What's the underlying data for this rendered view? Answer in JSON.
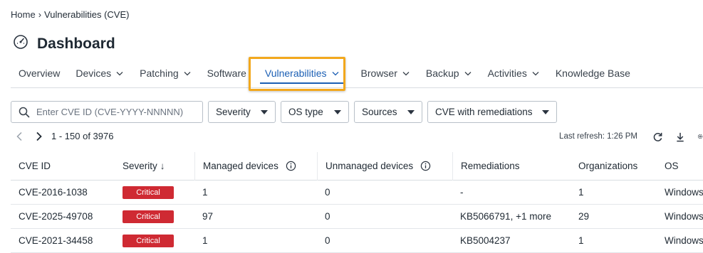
{
  "breadcrumb": {
    "home": "Home",
    "separator": "›",
    "current": "Vulnerabilities (CVE)"
  },
  "page": {
    "title": "Dashboard",
    "icon": "gauge-icon"
  },
  "tabs": [
    {
      "label": "Overview",
      "has_dropdown": false,
      "active": false
    },
    {
      "label": "Devices",
      "has_dropdown": true,
      "active": false
    },
    {
      "label": "Patching",
      "has_dropdown": true,
      "active": false
    },
    {
      "label": "Software",
      "has_dropdown": false,
      "active": false
    },
    {
      "label": "Vulnerabilities",
      "has_dropdown": true,
      "active": true
    },
    {
      "label": "Browser",
      "has_dropdown": true,
      "active": false
    },
    {
      "label": "Backup",
      "has_dropdown": true,
      "active": false
    },
    {
      "label": "Activities",
      "has_dropdown": true,
      "active": false
    },
    {
      "label": "Knowledge Base",
      "has_dropdown": false,
      "active": false
    }
  ],
  "filters": {
    "search_placeholder": "Enter CVE ID (CVE-YYYY-NNNNN)",
    "severity": "Severity",
    "os_type": "OS type",
    "sources": "Sources",
    "cve_remediations": "CVE with remediations"
  },
  "pagination": {
    "range": "1 - 150 of 3976"
  },
  "refresh": {
    "label": "Last refresh: 1:26 PM"
  },
  "table": {
    "headers": {
      "cve_id": "CVE ID",
      "severity": "Severity",
      "severity_sort": "↓",
      "managed": "Managed devices",
      "unmanaged": "Unmanaged devices",
      "remediations": "Remediations",
      "organizations": "Organizations",
      "os": "OS"
    },
    "rows": [
      {
        "cve_id": "CVE-2016-1038",
        "severity": "Critical",
        "managed": "1",
        "unmanaged": "0",
        "remediations": "-",
        "organizations": "1",
        "os": "Windows"
      },
      {
        "cve_id": "CVE-2025-49708",
        "severity": "Critical",
        "managed": "97",
        "unmanaged": "0",
        "remediations": "KB5066791, +1 more",
        "organizations": "29",
        "os": "Windows"
      },
      {
        "cve_id": "CVE-2021-34458",
        "severity": "Critical",
        "managed": "1",
        "unmanaged": "0",
        "remediations": "KB5004237",
        "organizations": "1",
        "os": "Windows"
      }
    ]
  },
  "colors": {
    "accent": "#1b5fb4",
    "highlight": "#f2a81d",
    "critical": "#cf2a33"
  }
}
